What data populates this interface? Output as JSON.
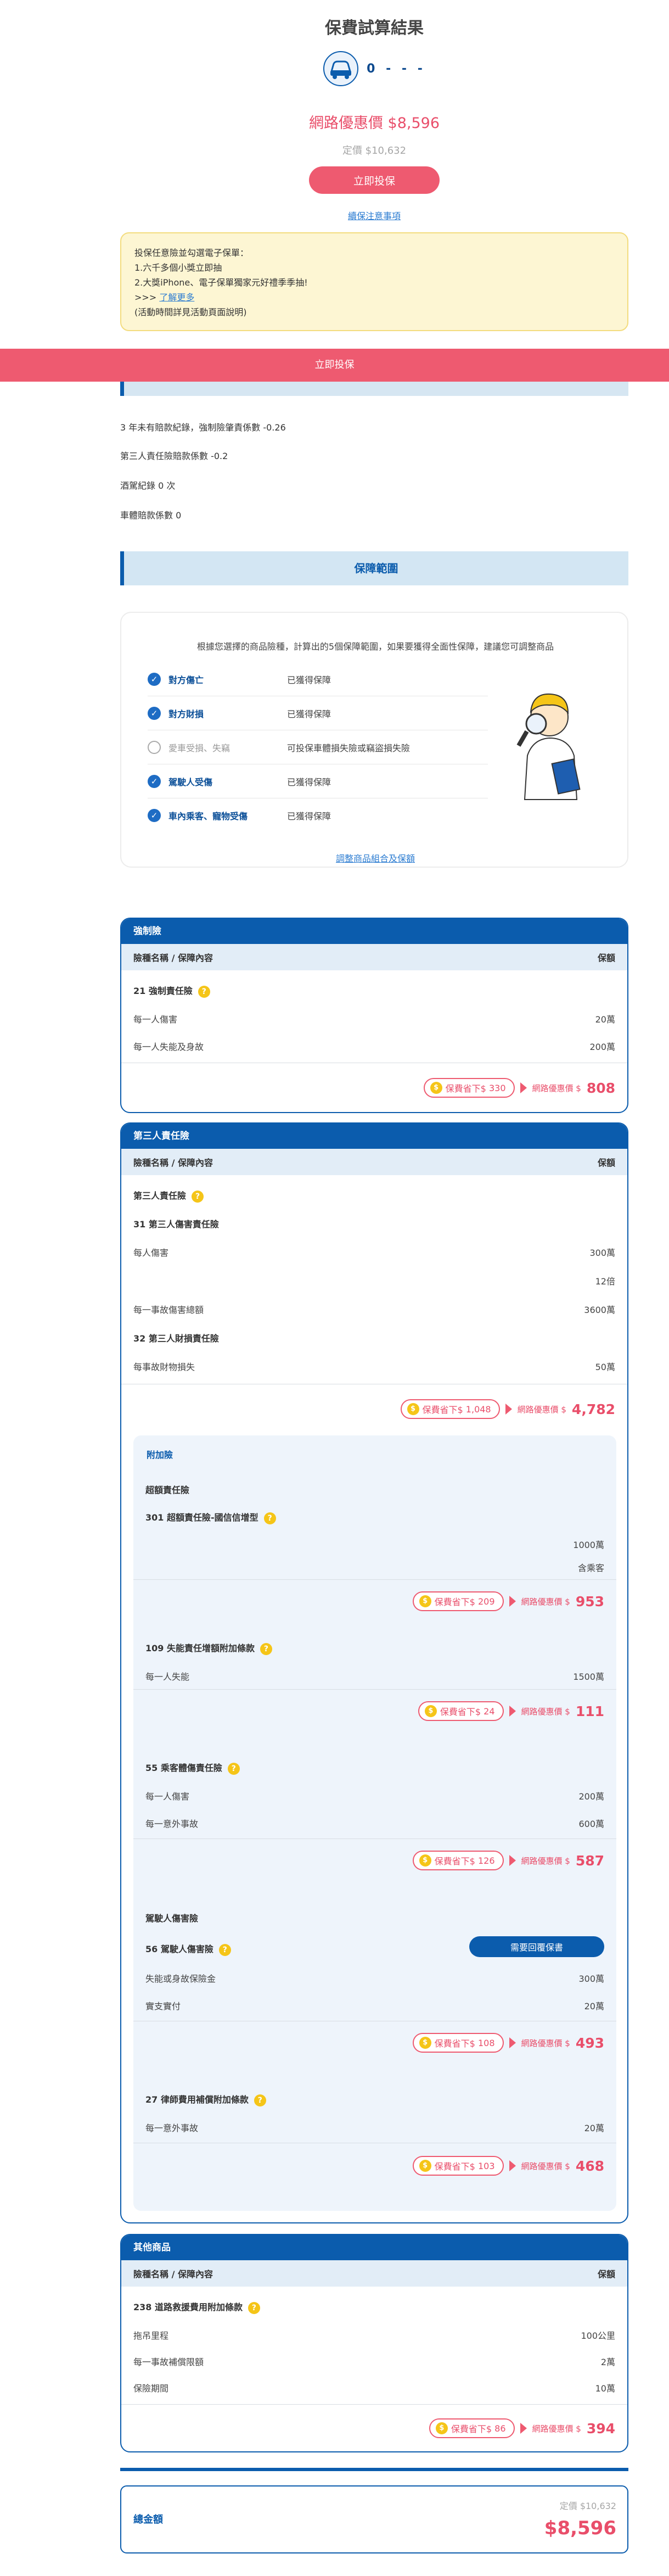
{
  "header": {
    "title": "保費試算結果",
    "plate": "0 - - -",
    "net_price": "網路優惠價 $8,596",
    "list_price": "定價 $10,632",
    "apply_button": "立即投保",
    "notice_link": "續保注意事項"
  },
  "promo": {
    "lines": [
      "投保任意險並勾選電子保單：",
      "1.六千多個小獎立即抽",
      "2.大獎iPhone、電子保單獨家元好禮季季抽!"
    ],
    "more_prefix": ">>>",
    "more_link": "了解更多",
    "footnote": "(活動時間詳見活動頁面說明)"
  },
  "sticky_bar": {
    "label": "立即投保"
  },
  "facts": [
    "3 年未有賠款紀錄，強制險肇責係數 -0.26",
    "第三人責任險賠款係數 -0.2",
    "酒駕紀錄 0 次",
    "車體賠款係數 0"
  ],
  "coverage": {
    "heading": "保障範圍",
    "intro": "根據您選擇的商品險種，計算出的5個保障範圍，如果要獲得全面性保障，建議您可調整商品",
    "items": [
      {
        "name": "對方傷亡",
        "status": "已獲得保障",
        "covered": true
      },
      {
        "name": "對方財損",
        "status": "已獲得保障",
        "covered": true
      },
      {
        "name": "愛車受損、失竊",
        "status": "可投保車體損失險或竊盜損失險",
        "covered": false
      },
      {
        "name": "駕駛人受傷",
        "status": "已獲得保障",
        "covered": true
      },
      {
        "name": "車內乘客、寵物受傷",
        "status": "已獲得保障",
        "covered": true
      }
    ],
    "adjust_link": "調整商品組合及保額"
  },
  "table_labels": {
    "col_left": "險種名稱 / 保障內容",
    "col_right": "保額",
    "save_prefix": "保費省下$",
    "net_label": "網路優惠價 $"
  },
  "compulsory": {
    "title": "強制險",
    "item": "21 強制責任險",
    "rows": [
      {
        "label": "每一人傷害",
        "value": "20萬"
      },
      {
        "label": "每一人失能及身故",
        "value": "200萬"
      }
    ],
    "save": "330",
    "net": "808"
  },
  "third_party": {
    "title": "第三人責任險",
    "item": "第三人責任險",
    "sub1": "31 第三人傷害責任險",
    "rows1": [
      {
        "label": "每人傷害",
        "value": "300萬"
      },
      {
        "label": "",
        "value": "12倍"
      },
      {
        "label": "每一事故傷害總額",
        "value": "3600萬"
      }
    ],
    "sub2": "32 第三人財損責任險",
    "rows2": [
      {
        "label": "每事故財物損失",
        "value": "50萬"
      }
    ],
    "save": "1,048",
    "net": "4,782",
    "addon_title": "附加險",
    "addons": {
      "group1": "超額責任險",
      "a301": {
        "name": "301 超額責任險-國信信增型",
        "rows": [
          {
            "label": "",
            "value": "1000萬"
          },
          {
            "label": "",
            "value": "含乘客"
          }
        ],
        "save": "209",
        "net": "953"
      },
      "a109": {
        "name": "109 失能責任增額附加條款",
        "rows": [
          {
            "label": "每一人失能",
            "value": "1500萬"
          }
        ],
        "save": "24",
        "net": "111"
      },
      "a55": {
        "name": "55 乘客體傷責任險",
        "rows": [
          {
            "label": "每一人傷害",
            "value": "200萬"
          },
          {
            "label": "每一意外事故",
            "value": "600萬"
          }
        ],
        "save": "126",
        "net": "587"
      },
      "group2": "駕駛人傷害險",
      "a56": {
        "name": "56 駕駛人傷害險",
        "button": "需要回覆保書",
        "rows": [
          {
            "label": "失能或身故保險金",
            "value": "300萬"
          },
          {
            "label": "實支實付",
            "value": "20萬"
          }
        ],
        "save": "108",
        "net": "493"
      },
      "a27": {
        "name": "27 律師費用補償附加條款",
        "rows": [
          {
            "label": "每一意外事故",
            "value": "20萬"
          }
        ],
        "save": "103",
        "net": "468"
      }
    }
  },
  "others": {
    "title": "其他商品",
    "item": "238 道路救援費用附加條款",
    "rows": [
      {
        "label": "拖吊里程",
        "value": "100公里"
      },
      {
        "label": "每一事故補償限額",
        "value": "2萬"
      },
      {
        "label": "保險期間",
        "value": "10萬"
      }
    ],
    "save": "86",
    "net": "394"
  },
  "total": {
    "label": "總金額",
    "list": "定價 $10,632",
    "net": "$8,596"
  },
  "colors": {
    "brand": "#0b5cad",
    "accent": "#ee5a70",
    "highlight": "#f5c518"
  }
}
